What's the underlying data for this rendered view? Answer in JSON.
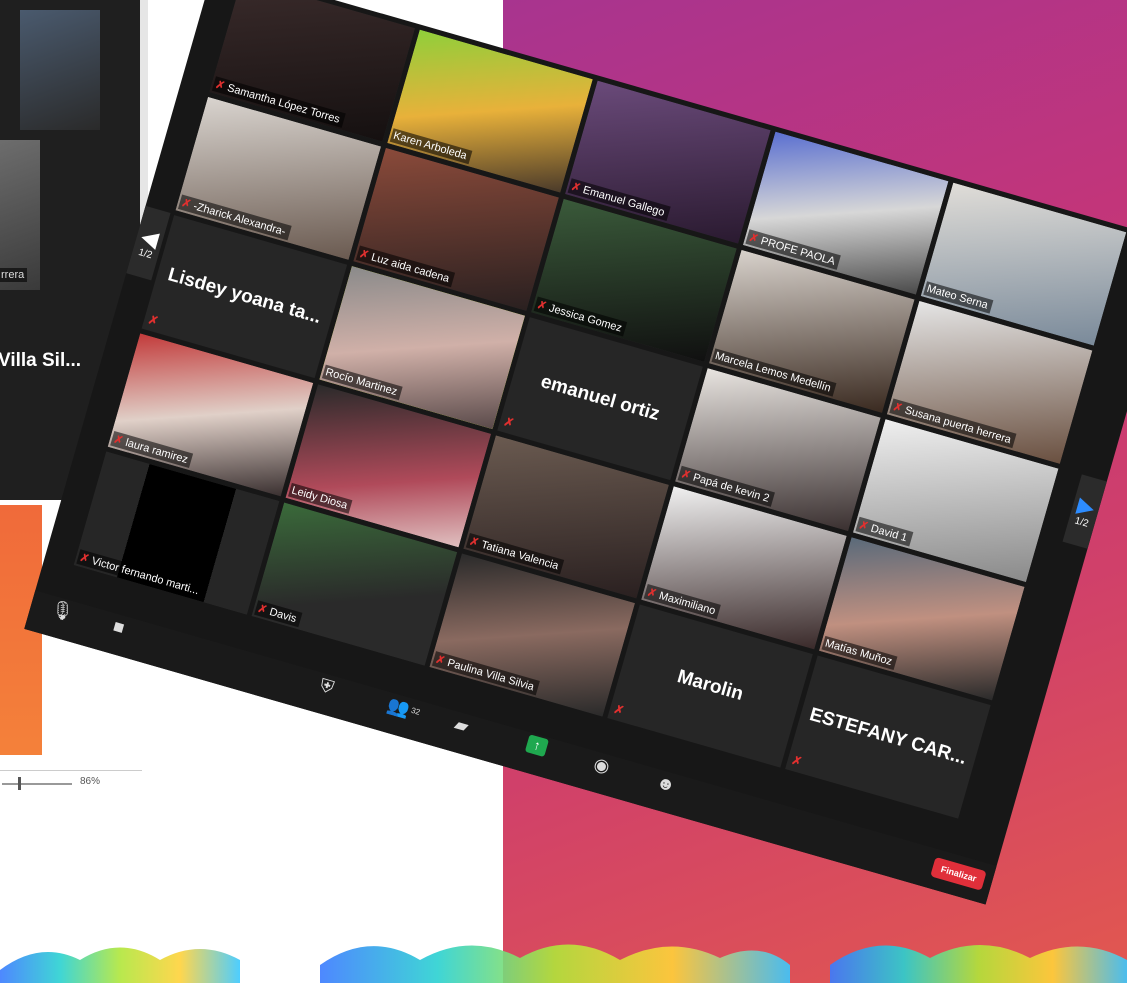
{
  "back_window": {
    "name_tag": "rrera",
    "big_name": "Villa Sil...",
    "zoom_level": "86%"
  },
  "nav": {
    "prev_page": "1/2",
    "next_page": "1/2"
  },
  "participants": [
    {
      "name": "Samantha López Torres"
    },
    {
      "name": "Karen Arboleda"
    },
    {
      "name": "Emanuel Gallego"
    },
    {
      "name": "PROFE PAOLA"
    },
    {
      "name": "Mateo Serna"
    },
    {
      "name": "-Zharick Alexandra-"
    },
    {
      "name": "Luz aida cadena"
    },
    {
      "name": "Jessica Gomez"
    },
    {
      "name": "Marcela Lemos Medellín"
    },
    {
      "name": "Susana puerta herrera"
    },
    {
      "name": "Lisdey yoana ta..."
    },
    {
      "name": "Rocío Martinez"
    },
    {
      "name": "emanuel ortiz"
    },
    {
      "name": "Papá de kevin 2"
    },
    {
      "name": "David 1"
    },
    {
      "name": "laura ramirez"
    },
    {
      "name": "Leidy Diosa"
    },
    {
      "name": "Tatiana Valencia"
    },
    {
      "name": "Maximiliano"
    },
    {
      "name": "Matías Muñoz"
    },
    {
      "name": "Victor fernando marti..."
    },
    {
      "name": "Davis"
    },
    {
      "name": "Paulina Villa Silvia"
    },
    {
      "name": "Marolin"
    },
    {
      "name": "ESTEFANY CAR..."
    }
  ],
  "toolbar": {
    "participants_count": "32",
    "end_label": "Finalizar"
  },
  "colors": {
    "accent_green": "#1fa84f",
    "active_speaker": "#c6d64a",
    "end_red": "#e02f3a",
    "muted_red": "#e0302f"
  }
}
